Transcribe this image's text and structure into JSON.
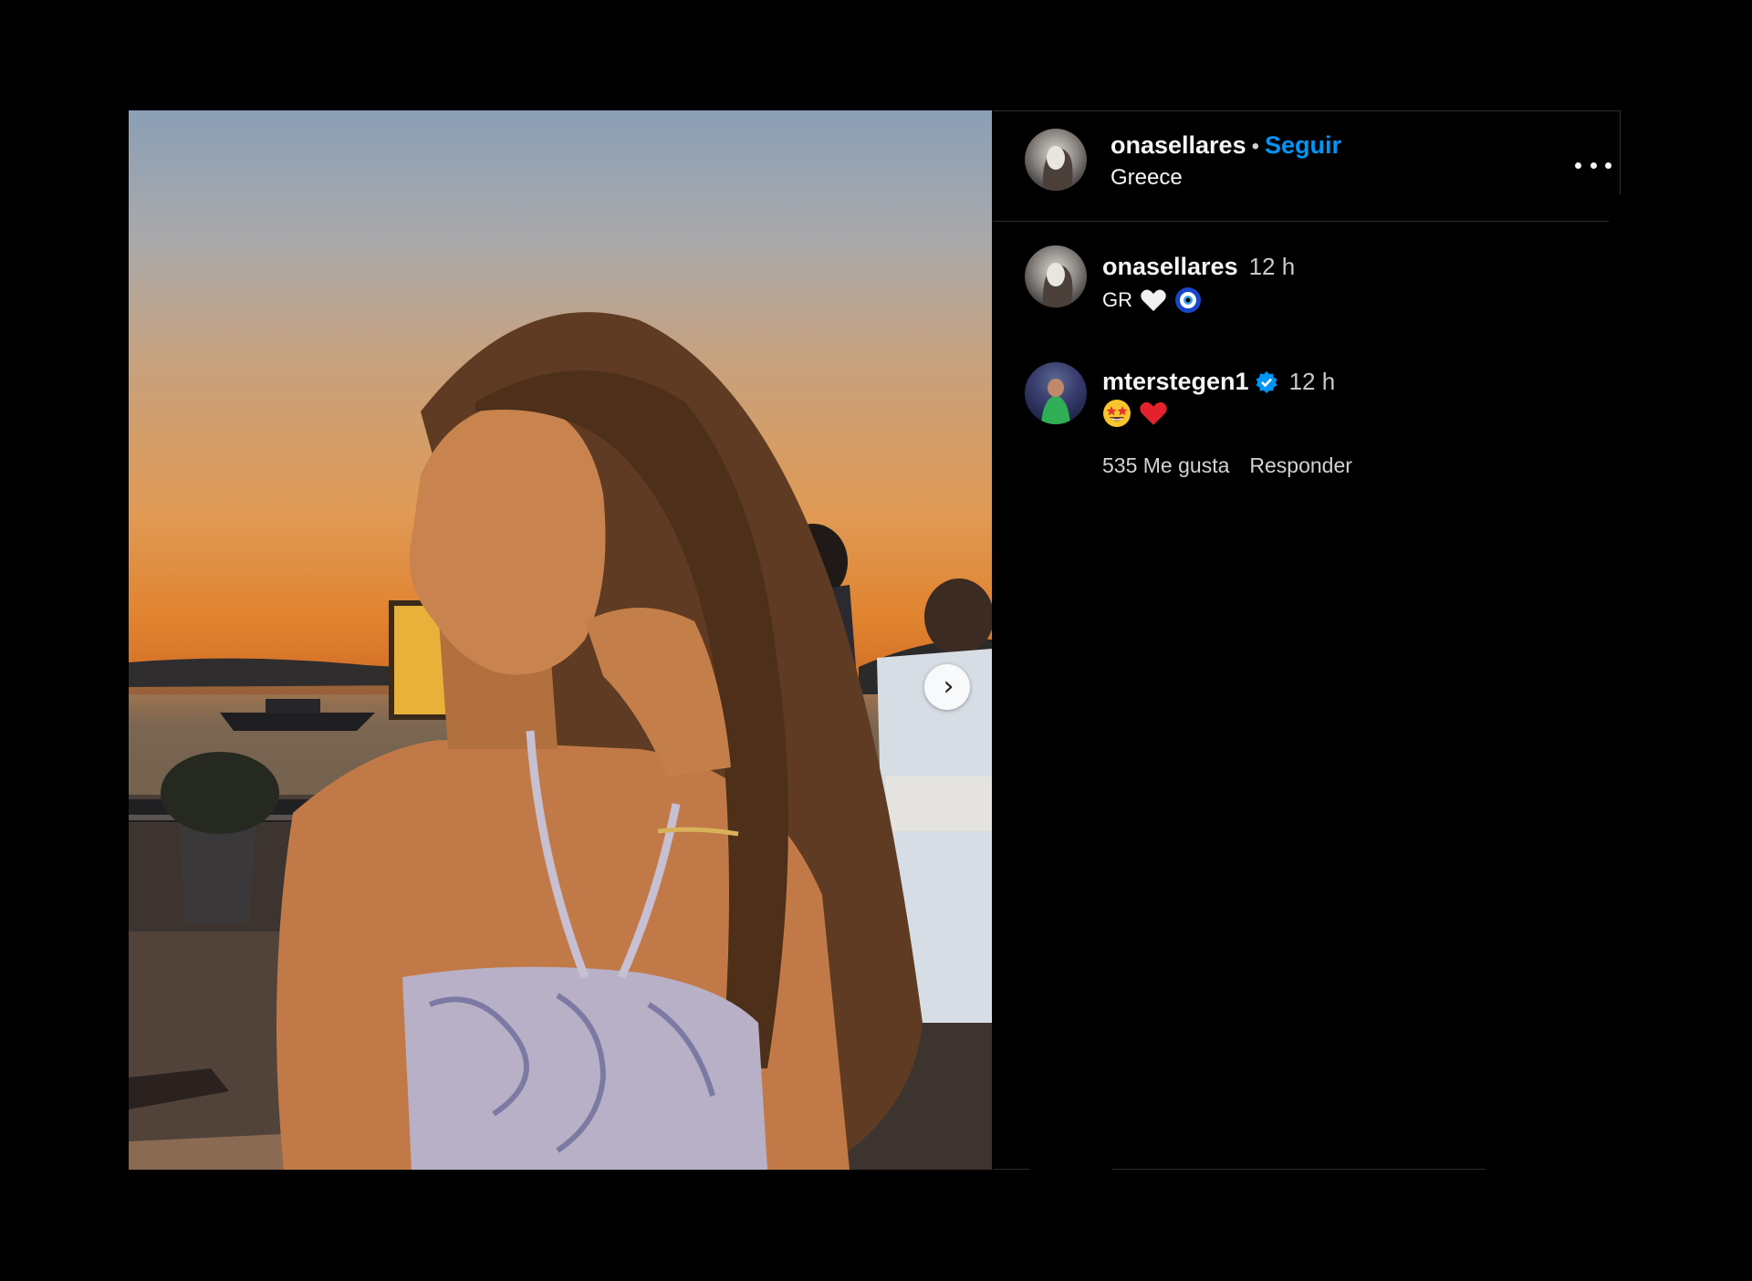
{
  "post": {
    "author": "onasellares",
    "separator": "•",
    "follow_label": "Seguir",
    "location": "Greece"
  },
  "comments": [
    {
      "username": "onasellares",
      "time": "12 h",
      "text": "GR",
      "emojis": [
        "white-heart",
        "nazar-amulet"
      ]
    },
    {
      "username": "mterstegen1",
      "verified": true,
      "time": "12 h",
      "emojis": [
        "star-struck",
        "red-heart"
      ],
      "likes": "535 Me gusta",
      "reply_label": "Responder"
    }
  ],
  "icons": {
    "more": "more-options-icon",
    "next": "chevron-right-icon",
    "verified": "verified-badge-icon"
  },
  "colors": {
    "background": "#000000",
    "accent": "#0095f6",
    "verified": "#0095f6",
    "text": "#f5f5f5"
  }
}
